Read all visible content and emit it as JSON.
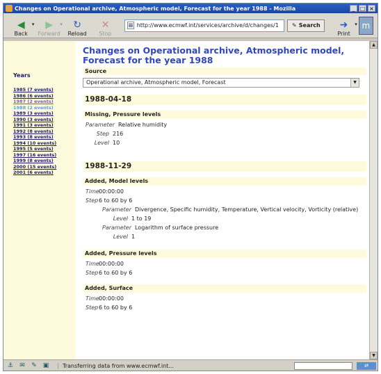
{
  "window": {
    "title": "Changes on Operational archive, Atmospheric model, Forecast for the year 1988 - Mozilla"
  },
  "toolbar": {
    "back": "Back",
    "forward": "Forward",
    "reload": "Reload",
    "stop": "Stop",
    "url": "http://www.ecmwf.int/services/archive/d/changes/1",
    "search": "Search",
    "print": "Print"
  },
  "sidebar": {
    "heading": "Years",
    "years": [
      {
        "label": "1985 (7 events)",
        "state": "link"
      },
      {
        "label": "1986 (6 events)",
        "state": "link"
      },
      {
        "label": "1987 (2 events)",
        "state": "visited"
      },
      {
        "label": "1988 (2 events)",
        "state": "current"
      },
      {
        "label": "1989 (3 events)",
        "state": "link"
      },
      {
        "label": "1990 (3 events)",
        "state": "link"
      },
      {
        "label": "1991 (3 events)",
        "state": "link"
      },
      {
        "label": "1992 (8 events)",
        "state": "link"
      },
      {
        "label": "1993 (8 events)",
        "state": "link"
      },
      {
        "label": "1994 (10 events)",
        "state": "link"
      },
      {
        "label": "1995 (5 events)",
        "state": "link"
      },
      {
        "label": "1997 (16 events)",
        "state": "link"
      },
      {
        "label": "1999 (8 events)",
        "state": "link"
      },
      {
        "label": "2000 (15 events)",
        "state": "link"
      },
      {
        "label": "2001 (6 events)",
        "state": "link"
      }
    ]
  },
  "main": {
    "title": "Changes on Operational archive, Atmospheric model, Forecast for the year 1988",
    "source_heading": "Source",
    "source_value": "Operational archive, Atmospheric model, Forecast",
    "events": [
      {
        "date": "1988-04-18",
        "groups": [
          {
            "heading": "Missing, Pressure levels",
            "param_label": "Parameter",
            "param": "Relative humidity",
            "step_label": "Step",
            "step": "216",
            "level_label": "Level",
            "level": "10"
          }
        ]
      },
      {
        "date": "1988-11-29",
        "groups": [
          {
            "heading": "Added, Model levels",
            "time_label": "Time",
            "time": "00:00:00",
            "step_label": "Step",
            "step": "6 to 60 by 6",
            "param1_label": "Parameter",
            "param1": "Divergence, Specific humidity, Temperature, Vertical velocity, Vorticity (relative)",
            "level1_label": "Level",
            "level1": "1 to 19",
            "param2_label": "Parameter",
            "param2": "Logarithm of surface pressure",
            "level2_label": "Level",
            "level2": "1"
          },
          {
            "heading": "Added, Pressure levels",
            "time_label": "Time",
            "time": "00:00:00",
            "step_label": "Step",
            "step": "6 to 60 by 6"
          },
          {
            "heading": "Added, Surface",
            "time_label": "Time",
            "time": "00:00:00",
            "step_label": "Step",
            "step": "6 to 60 by 6"
          }
        ]
      }
    ]
  },
  "status": {
    "text": "Transferring data from www.ecmwf.int..."
  },
  "colors": {
    "title_blue": "#3046c0",
    "band_yellow": "#fefbdc",
    "titlebar": "#1c46a8"
  }
}
